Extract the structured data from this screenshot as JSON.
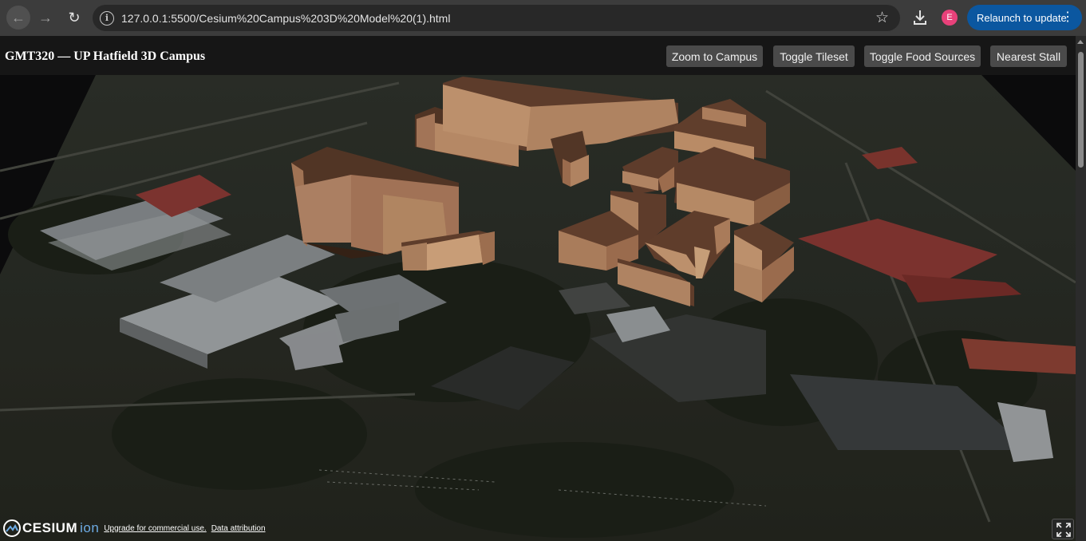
{
  "browser": {
    "url": "127.0.0.1:5500/Cesium%20Campus%203D%20Model%20(1).html",
    "profile_initial": "E",
    "relaunch_label": "Relaunch to update"
  },
  "app": {
    "title": "GMT320 — UP Hatfield 3D Campus",
    "buttons": {
      "zoom_campus": "Zoom to Campus",
      "toggle_tileset": "Toggle Tileset",
      "toggle_food": "Toggle Food Sources",
      "nearest_stall": "Nearest Stall"
    }
  },
  "credits": {
    "logo_text": "CESIUM",
    "logo_suffix": "ion",
    "upgrade_link": "Upgrade for commercial use.",
    "attribution_link": "Data attribution"
  },
  "colors": {
    "accent": "#0b57a0",
    "building_light": "#c89670",
    "building_dark": "#6b4632"
  },
  "icons": {
    "back": "arrow-left-icon",
    "forward": "arrow-right-icon",
    "reload": "reload-icon",
    "info": "info-icon",
    "star": "star-icon",
    "download": "download-icon",
    "menu": "kebab-icon",
    "fullscreen": "fullscreen-icon"
  }
}
